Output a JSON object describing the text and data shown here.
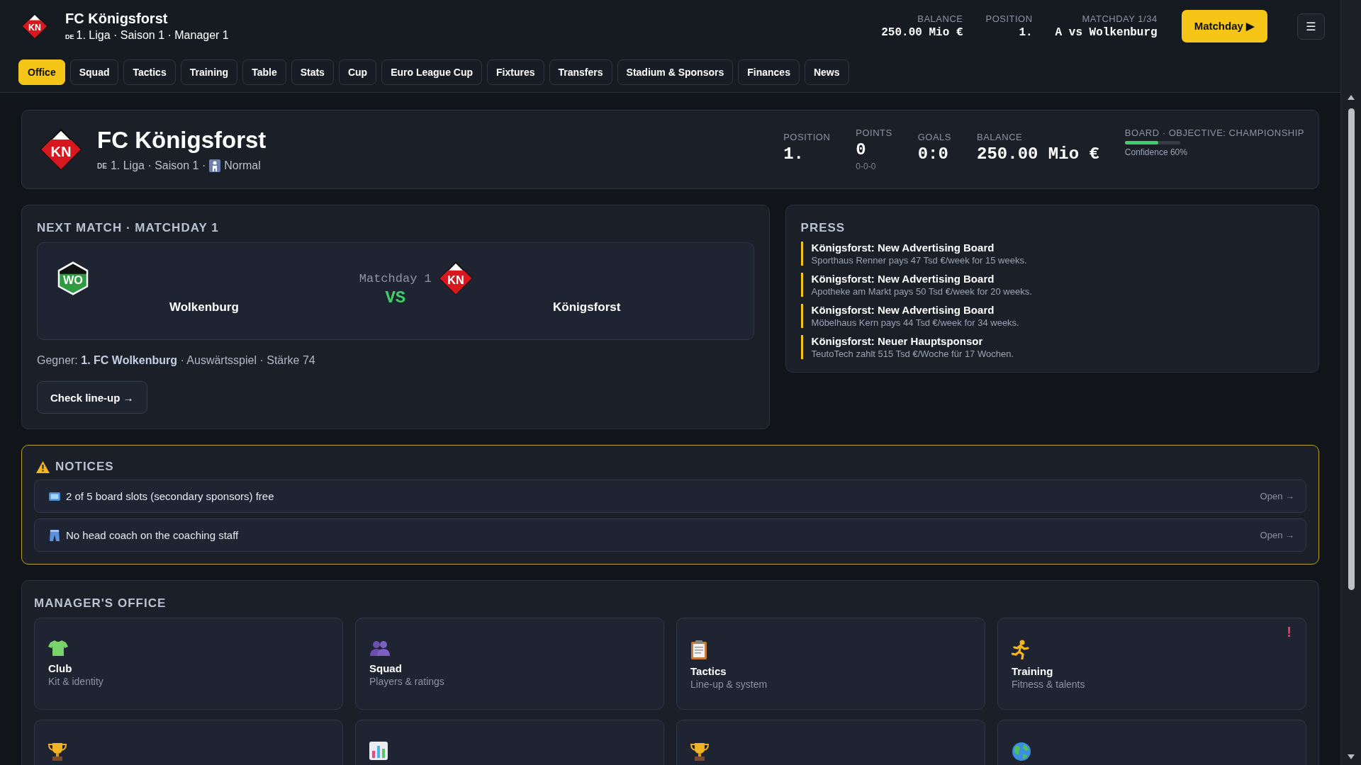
{
  "header": {
    "crest": {
      "kind": "diamond",
      "abbr": "KN"
    },
    "title": "FC Königsforst",
    "flag": "DE",
    "subtitle": "1. Liga · Saison 1 · Manager 1",
    "stats": [
      {
        "label": "BALANCE",
        "value": "250.00 Mio €"
      },
      {
        "label": "POSITION",
        "value": "1."
      },
      {
        "label": "MATCHDAY 1/34",
        "value": "A vs Wolkenburg"
      }
    ],
    "matchday_button": "Matchday ▶",
    "menu_button": "☰"
  },
  "tabs": [
    {
      "label": "Office",
      "selected": true
    },
    {
      "label": "Squad",
      "selected": false
    },
    {
      "label": "Tactics",
      "selected": false
    },
    {
      "label": "Training",
      "selected": false
    },
    {
      "label": "Table",
      "selected": false
    },
    {
      "label": "Stats",
      "selected": false
    },
    {
      "label": "Cup",
      "selected": false
    },
    {
      "label": "Euro League Cup",
      "selected": false
    },
    {
      "label": "Fixtures",
      "selected": false
    },
    {
      "label": "Transfers",
      "selected": false
    },
    {
      "label": "Stadium & Sponsors",
      "selected": false
    },
    {
      "label": "Finances",
      "selected": false
    },
    {
      "label": "News",
      "selected": false
    }
  ],
  "club": {
    "crest": {
      "kind": "diamond",
      "abbr": "KN"
    },
    "name": "FC Königsforst",
    "flag": "DE",
    "subtitle": "1. Liga · Saison 1 ·",
    "difficulty": "Normal",
    "stats": [
      {
        "label": "POSITION",
        "value": "1."
      },
      {
        "label": "POINTS",
        "value": "0",
        "note": "0-0-0"
      },
      {
        "label": "GOALS",
        "value": "0:0"
      },
      {
        "label": "BALANCE",
        "value": "250.00 Mio €"
      }
    ],
    "board": {
      "label": "BOARD · OBJECTIVE: CHAMPIONSHIP",
      "level": 0.6,
      "confidence": "Confidence 60%"
    }
  },
  "next_match": {
    "title": "NEXT MATCH · MATCHDAY 1",
    "home": {
      "name": "Wolkenburg",
      "crest": {
        "kind": "hexagon",
        "abbr": "WO"
      }
    },
    "matchday": "Matchday 1",
    "vs": "VS",
    "away": {
      "name": "Königsforst",
      "crest": {
        "kind": "diamond",
        "abbr": "KN"
      }
    },
    "opponent_line": "Gegner: **1. FC Wolkenburg** · Auswärtsspiel · Stärke 74",
    "button": "Check line-up →"
  },
  "press": {
    "title": "PRESS",
    "items": [
      {
        "headline": "Königsforst: New Advertising Board",
        "text": "Sporthaus Renner pays 47 Tsd €/week for 15 weeks."
      },
      {
        "headline": "Königsforst: New Advertising Board",
        "text": "Apotheke am Markt pays 50 Tsd €/week for 20 weeks."
      },
      {
        "headline": "Königsforst: New Advertising Board",
        "text": "Möbelhaus Kern pays 44 Tsd €/week for 34 weeks."
      },
      {
        "headline": "Königsforst: Neuer Hauptsponsor",
        "text": "TeutoTech zahlt 515 Tsd €/Woche für 17 Wochen."
      }
    ]
  },
  "notices": {
    "title": "NOTICES",
    "items": [
      {
        "text": "2 of 5 board slots (secondary sponsors) free",
        "link": "Open →"
      },
      {
        "text": "No head coach on the coaching staff",
        "link": "Open →"
      }
    ]
  },
  "office": {
    "title": "MANAGER'S OFFICE",
    "tiles": [
      {
        "kind": "labeled",
        "title": "Club",
        "subtitle": "Kit & identity"
      },
      {
        "kind": "labeled",
        "title": "Squad",
        "subtitle": "Players & ratings"
      },
      {
        "kind": "labeled",
        "title": "Tactics",
        "subtitle": "Line-up & system"
      },
      {
        "kind": "labeled",
        "title": "Training",
        "subtitle": "Fitness & talents",
        "badge": "!"
      },
      {
        "kind": "cut"
      },
      {
        "kind": "cut"
      },
      {
        "kind": "cut"
      },
      {
        "kind": "cut"
      }
    ]
  }
}
